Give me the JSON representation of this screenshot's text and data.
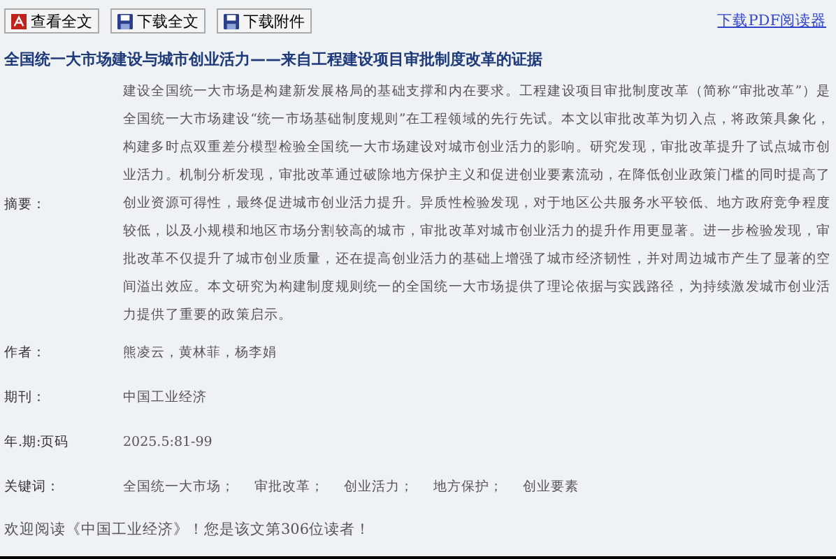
{
  "toolbar": {
    "buttons": [
      {
        "label": "查看全文",
        "kind": "pdf"
      },
      {
        "label": "下载全文",
        "kind": "disk"
      },
      {
        "label": "下载附件",
        "kind": "disk"
      }
    ],
    "reader_link": "下载PDF阅读器"
  },
  "title": "全国统一大市场建设与城市创业活力——来自工程建设项目审批制度改革的证据",
  "fields": [
    {
      "label": "摘要：",
      "kind": "abstract",
      "value": "建设全国统一大市场是构建新发展格局的基础支撑和内在要求。工程建设项目审批制度改革（简称“审批改革”）是全国统一大市场建设“统一市场基础制度规则”在工程领域的先行先试。本文以审批改革为切入点，将政策具象化，构建多时点双重差分模型检验全国统一大市场建设对城市创业活力的影响。研究发现，审批改革提升了试点城市创业活力。机制分析发现，审批改革通过破除地方保护主义和促进创业要素流动，在降低创业政策门槛的同时提高了创业资源可得性，最终促进城市创业活力提升。异质性检验发现，对于地区公共服务水平较低、地方政府竞争程度较低，以及小规模和地区市场分割较高的城市，审批改革对城市创业活力的提升作用更显著。进一步检验发现，审批改革不仅提升了城市创业质量，还在提高创业活力的基础上增强了城市经济韧性，并对周边城市产生了显著的空间溢出效应。本文研究为构建制度规则统一的全国统一大市场提供了理论依据与实践路径，为持续激发城市创业活力提供了重要的政策启示。"
    },
    {
      "label": "作者：",
      "kind": "text",
      "value": "熊凌云，黄林菲，杨李娟"
    },
    {
      "label": "期刊：",
      "kind": "text",
      "value": "中国工业经济"
    },
    {
      "label": "年.期:页码",
      "kind": "text",
      "value": "2025.5:81-99"
    },
    {
      "label": "关键词：",
      "kind": "keywords",
      "items": [
        "全国统一大市场；",
        "审批改革；",
        "创业活力；",
        "地方保护；",
        "创业要素"
      ]
    }
  ],
  "footer": "欢迎阅读《中国工业经济》！您是该文第306位读者！"
}
